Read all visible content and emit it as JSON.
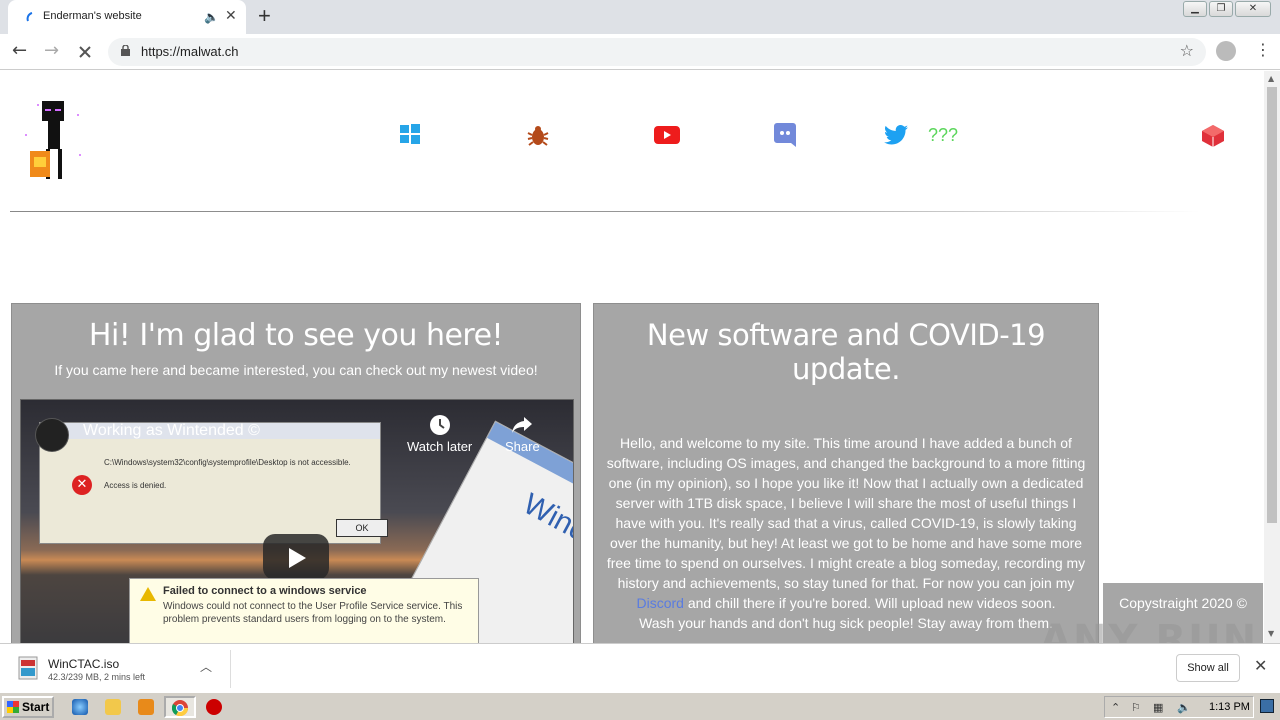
{
  "browser": {
    "tab_title": "Enderman's website",
    "new_tab_label": "+",
    "url": "https://malwat.ch",
    "window_controls": [
      "minimize",
      "restore",
      "close"
    ]
  },
  "nav": {
    "icons": [
      "windows-icon",
      "bug-icon",
      "youtube-icon",
      "discord-icon",
      "twitter-icon",
      "roblox-icon"
    ],
    "mystery_link": "???"
  },
  "card_left": {
    "title": "Hi! I'm glad to see you here!",
    "subtitle": "If you came here and became interested, you can check out my newest video!",
    "video": {
      "title": "Working as Wintended ©",
      "watch_later": "Watch later",
      "share": "Share",
      "dialog_path": "C:\\Windows\\system32\\config\\systemprofile\\Desktop is not accessible.",
      "dialog_denied": "Access is denied.",
      "dialog_ok": "OK",
      "warn_title": "Failed to connect to a windows service",
      "warn_text": "Windows could not connect to the User Profile Service service. This problem prevents standard users from logging on to the system.",
      "xp_text": "Windo"
    }
  },
  "card_right": {
    "title": "New software and COVID-19 update.",
    "body_before_link": "Hello, and welcome to my site. This time around I have added a bunch of software, including OS images, and changed the background to a more fitting one (in my opinion), so I hope you like it! Now that I actually own a dedicated server with 1TB disk space, I believe I will share the most of useful things I have with you. It's really sad that a virus, called COVID-19, is slowly taking over the humanity, but hey! At least we got to be home and have some more free time to spend on ourselves. I might create a blog someday, recording my history and achievements, so stay tuned for that. For now you can join my ",
    "link_text": "Discord",
    "body_after_link": " and chill there if you're bored. Will upload new videos soon.",
    "body_last": "Wash your hands and don't hug sick people! Stay away from them."
  },
  "footer": {
    "copyright": "Copystraight 2020 ©"
  },
  "watermark": "ANY RUN",
  "download": {
    "filename": "WinCTAC.iso",
    "status": "42.3/239 MB, 2 mins left",
    "show_all": "Show all"
  },
  "taskbar": {
    "start_label": "Start",
    "clock": "1:13 PM"
  }
}
